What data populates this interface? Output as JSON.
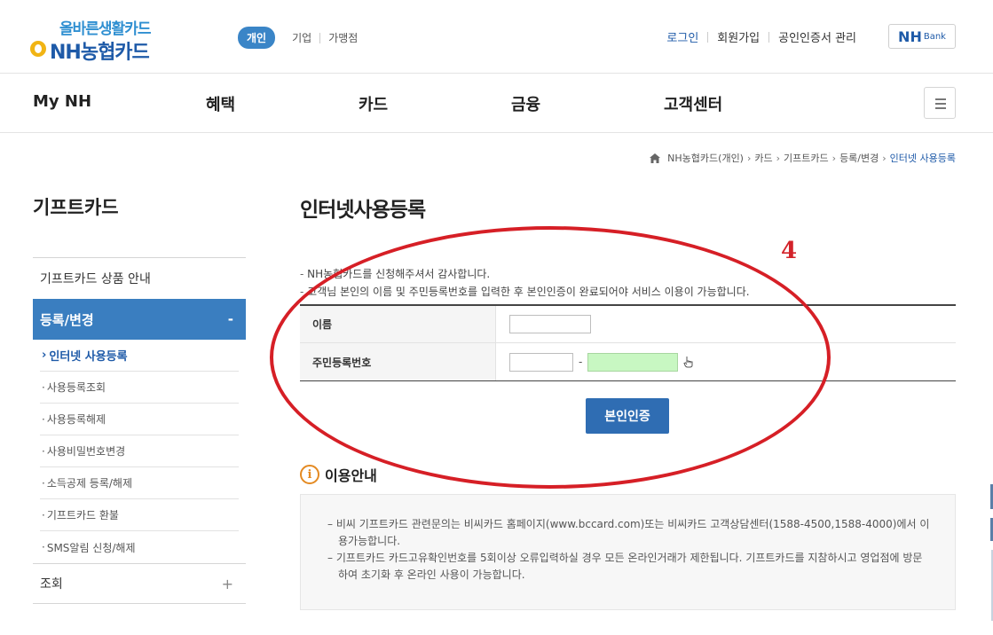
{
  "header": {
    "slogan": "올바른생활카드",
    "brand": "NH농협카드",
    "segments": [
      "개인",
      "기업",
      "가맹점"
    ],
    "util_links": [
      "로그인",
      "회원가입",
      "공인인증서 관리"
    ],
    "nhbank": {
      "main": "NH",
      "sub": "Bank"
    }
  },
  "gnb": {
    "items": [
      "My NH",
      "혜택",
      "카드",
      "금융",
      "고객센터"
    ]
  },
  "breadcrumb": [
    "NH농협카드(개인)",
    "카드",
    "기프트카드",
    "등록/변경",
    "인터넷 사용등록"
  ],
  "sidebar": {
    "title": "기프트카드",
    "top_item": "기프트카드 상품 안내",
    "active": {
      "label": "등록/변경",
      "toggle": "-"
    },
    "sub_items": [
      "인터넷 사용등록",
      "사용등록조회",
      "사용등록해제",
      "사용비밀번호변경",
      "소득공제 등록/해제",
      "기프트카드 환불",
      "SMS알림 신청/해제"
    ],
    "bottom": {
      "label": "조회",
      "toggle": "+"
    }
  },
  "content": {
    "title": "인터넷사용등록",
    "step_number": "4",
    "notices": [
      "NH농협카드를 신청해주셔서 감사합니다.",
      "고객님 본인의 이름 및 주민등록번호를 입력한 후 본인인증이 완료되어야 서비스 이용이 가능합니다."
    ],
    "form": {
      "name_label": "이름",
      "name_value": "",
      "rrn_label": "주민등록번호",
      "rrn_front": "",
      "rrn_back": "",
      "rrn_dash": "-"
    },
    "verify_button": "본인인증",
    "info_title": "이용안내",
    "info_items": [
      "비씨 기프트카드 관련문의는 비씨카드 홈페이지(www.bccard.com)또는 비씨카드 고객상담센터(1588-4500,1588-4000)에서 이용가능합니다.",
      "기프트카드 카드고유확인번호를 5회이상 오류입력하실 경우 모든 온라인거래가 제한됩니다. 기프트카드를 지참하시고 영업점에 방문하여 초기화 후 온라인 사용이 가능합니다."
    ]
  },
  "colors": {
    "accent": "#3a7ec0",
    "brand": "#1e5aa8",
    "annotation": "#d61f26",
    "highlight_input": "#c8f7c2"
  }
}
